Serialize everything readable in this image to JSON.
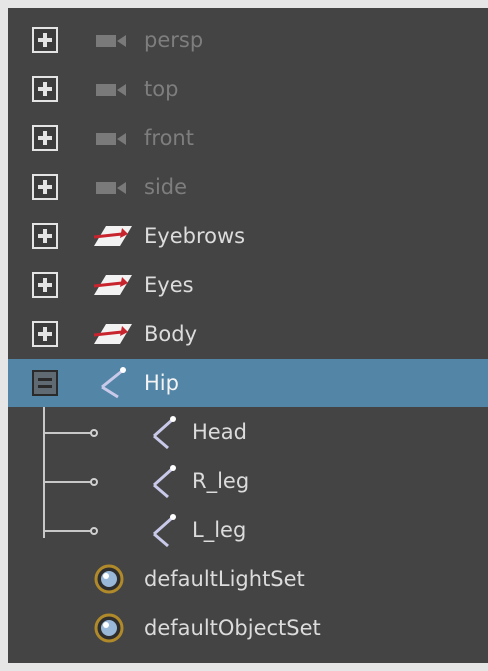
{
  "outliner": {
    "cameras": [
      {
        "label": "persp",
        "icon": "camera-icon"
      },
      {
        "label": "top",
        "icon": "camera-icon"
      },
      {
        "label": "front",
        "icon": "camera-icon"
      },
      {
        "label": "side",
        "icon": "camera-icon"
      }
    ],
    "meshes": [
      {
        "label": "Eyebrows",
        "icon": "mesh-transform-icon"
      },
      {
        "label": "Eyes",
        "icon": "mesh-transform-icon"
      },
      {
        "label": "Body",
        "icon": "mesh-transform-icon"
      }
    ],
    "hip": {
      "label": "Hip",
      "icon": "joint-icon",
      "expanded": true,
      "selected": true
    },
    "hip_children": [
      {
        "label": "Head",
        "icon": "joint-icon"
      },
      {
        "label": "R_leg",
        "icon": "joint-icon"
      },
      {
        "label": "L_leg",
        "icon": "joint-icon"
      }
    ],
    "sets": [
      {
        "label": "defaultLightSet",
        "icon": "object-set-icon"
      },
      {
        "label": "defaultObjectSet",
        "icon": "object-set-icon"
      }
    ]
  },
  "colors": {
    "background": "#444444",
    "selection": "#5285a6",
    "text": "#dcdcdc",
    "text_dim": "#7e7e7e",
    "mesh_icon_red": "#c8242e"
  }
}
